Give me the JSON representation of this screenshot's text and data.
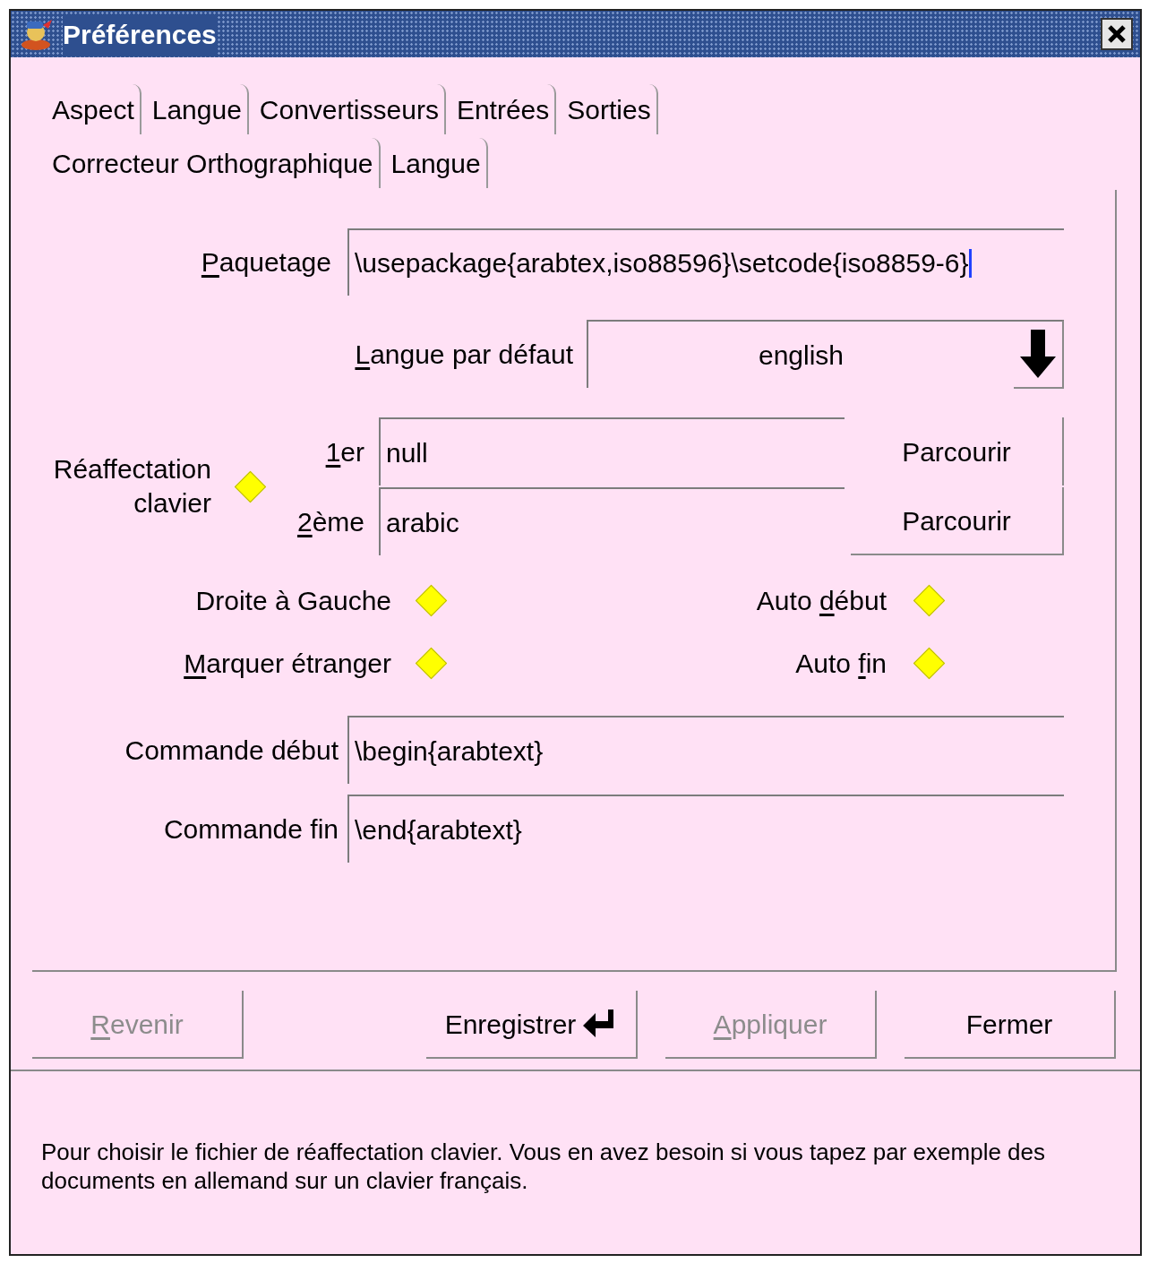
{
  "window": {
    "title": "Préférences"
  },
  "tab_rows": [
    {
      "tabs": [
        {
          "label": "Aspect"
        },
        {
          "label": "Langue"
        },
        {
          "label": "Convertisseurs"
        },
        {
          "label": "Entrées"
        },
        {
          "label": "Sorties"
        }
      ]
    },
    {
      "tabs": [
        {
          "label": "Correcteur Orthographique"
        },
        {
          "label": "Langue"
        }
      ]
    }
  ],
  "package": {
    "label_parts": [
      {
        "text": "P",
        "underlined": true
      },
      {
        "text": "aquetage"
      }
    ],
    "value": "\\usepackage{arabtex,iso88596}\\setcode{iso8859-6}",
    "focused": true
  },
  "default_language": {
    "label_parts": [
      {
        "text": "L",
        "underlined": true
      },
      {
        "text": "angue par défaut"
      }
    ],
    "value": "english"
  },
  "keymap": {
    "label": "Réaffectation clavier",
    "checked": true,
    "entries": [
      {
        "label_parts": [
          {
            "text": "1",
            "underlined": true
          },
          {
            "text": "er"
          }
        ],
        "value": "null",
        "button": "Parcourir"
      },
      {
        "label_parts": [
          {
            "text": "2",
            "underlined": true
          },
          {
            "text": "ème"
          }
        ],
        "value": "arabic",
        "button": "Parcourir"
      }
    ]
  },
  "options": [
    {
      "label_parts": [
        {
          "text": "Droite à Gauche"
        }
      ],
      "checked": true
    },
    {
      "label_parts": [
        {
          "text": "Auto "
        },
        {
          "text": "d",
          "underlined": true
        },
        {
          "text": "ébut"
        }
      ],
      "checked": true
    },
    {
      "label_parts": [
        {
          "text": "M",
          "underlined": true
        },
        {
          "text": "arquer étranger"
        }
      ],
      "checked": true
    },
    {
      "label_parts": [
        {
          "text": "Auto "
        },
        {
          "text": "f",
          "underlined": true
        },
        {
          "text": "in"
        }
      ],
      "checked": true
    }
  ],
  "commands": [
    {
      "label": "Commande début",
      "value": "\\begin{arabtext}"
    },
    {
      "label": "Commande fin",
      "value": "\\end{arabtext}"
    }
  ],
  "buttons": [
    {
      "kind": "plain",
      "label_parts": [
        {
          "text": "R",
          "underlined": true
        },
        {
          "text": "evenir"
        }
      ],
      "disabled": true
    },
    {
      "kind": "default",
      "label_parts": [
        {
          "text": "Enregistrer"
        }
      ],
      "disabled": false
    },
    {
      "kind": "plain",
      "label_parts": [
        {
          "text": "A",
          "underlined": true
        },
        {
          "text": "ppliquer"
        }
      ],
      "disabled": true
    },
    {
      "kind": "plain",
      "label_parts": [
        {
          "text": "Fermer"
        }
      ],
      "disabled": false
    }
  ],
  "help_text": "Pour choisir le fichier de réaffectation clavier. Vous en avez besoin si vous tapez par exemple des documents en allemand sur un clavier français."
}
